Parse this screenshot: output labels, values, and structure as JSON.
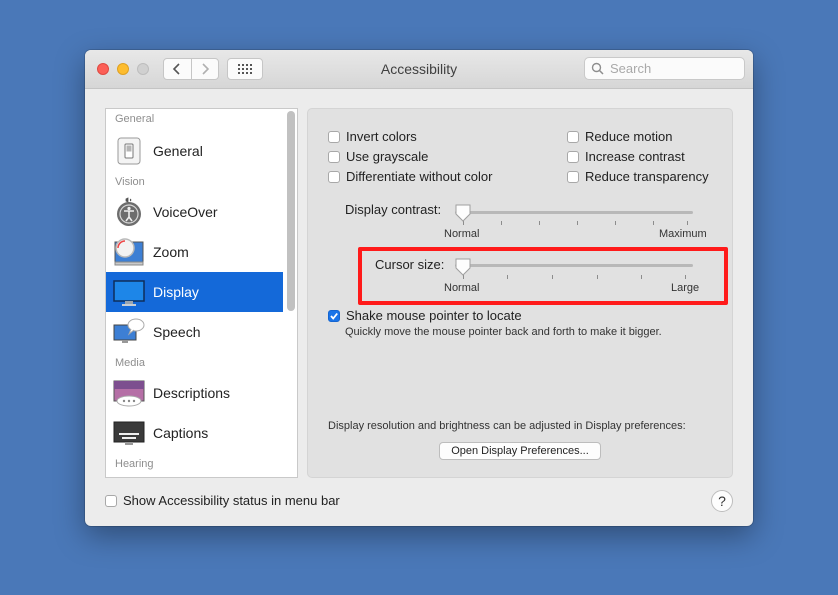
{
  "window": {
    "title": "Accessibility"
  },
  "search": {
    "placeholder": "Search"
  },
  "sidebar": {
    "sections": [
      "General",
      "Vision",
      "Media",
      "Hearing"
    ],
    "items": [
      {
        "label": "General",
        "icon": "switch-icon"
      },
      {
        "label": "VoiceOver",
        "icon": "voiceover-icon"
      },
      {
        "label": "Zoom",
        "icon": "zoom-icon"
      },
      {
        "label": "Display",
        "icon": "display-icon",
        "selected": true
      },
      {
        "label": "Speech",
        "icon": "speech-icon"
      },
      {
        "label": "Descriptions",
        "icon": "descriptions-icon"
      },
      {
        "label": "Captions",
        "icon": "captions-icon"
      }
    ]
  },
  "display": {
    "options_left": [
      {
        "label": "Invert colors",
        "checked": false
      },
      {
        "label": "Use grayscale",
        "checked": false
      },
      {
        "label": "Differentiate without color",
        "checked": false
      }
    ],
    "options_right": [
      {
        "label": "Reduce motion",
        "checked": false
      },
      {
        "label": "Increase contrast",
        "checked": false
      },
      {
        "label": "Reduce transparency",
        "checked": false
      }
    ],
    "contrast": {
      "label": "Display contrast:",
      "min_label": "Normal",
      "max_label": "Maximum",
      "value": 0
    },
    "cursor": {
      "label": "Cursor size:",
      "min_label": "Normal",
      "max_label": "Large",
      "value": 0
    },
    "shake": {
      "label": "Shake mouse pointer to locate",
      "checked": true,
      "description": "Quickly move the mouse pointer back and forth to make it bigger."
    },
    "resolution_note": "Display resolution and brightness can be adjusted in Display preferences:",
    "open_button": "Open Display Preferences..."
  },
  "footer": {
    "status_label": "Show Accessibility status in menu bar",
    "status_checked": false,
    "help": "?"
  },
  "colors": {
    "accent": "#1469d9",
    "highlight": "#ff1a1a",
    "desktop": "#4a78b8"
  }
}
